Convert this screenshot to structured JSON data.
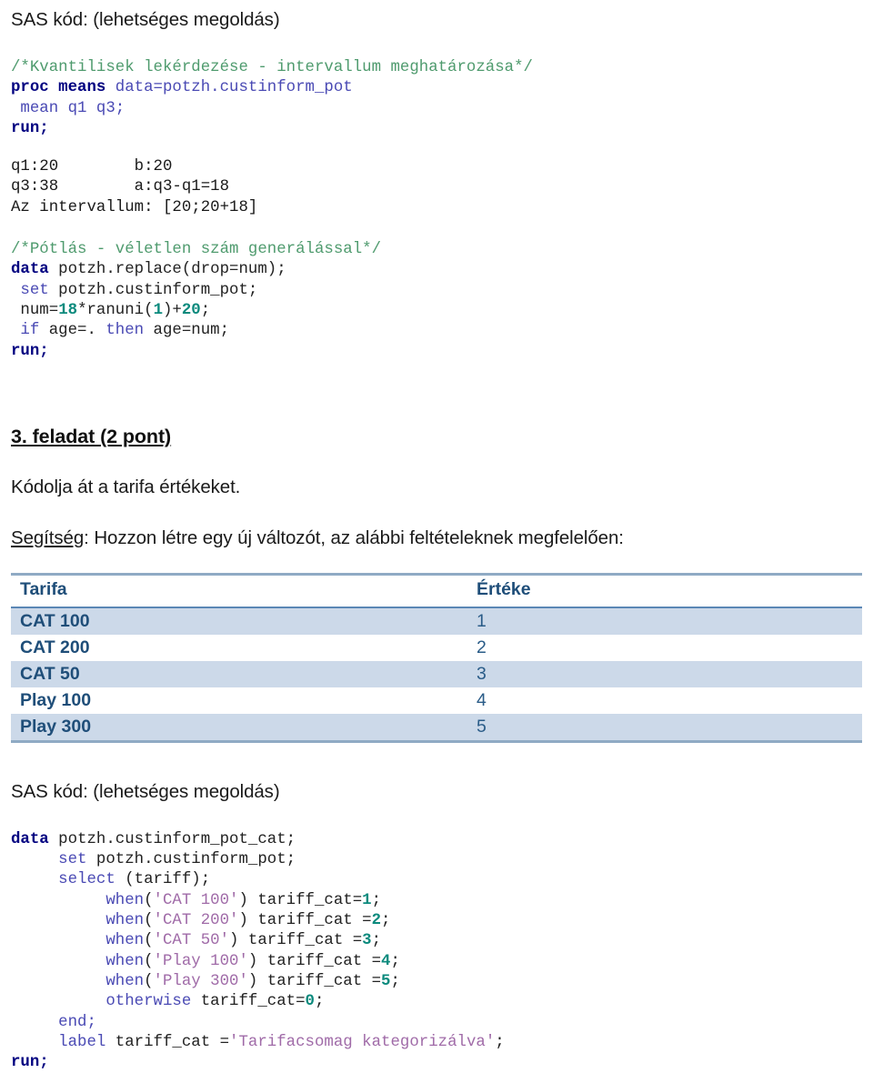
{
  "document": {
    "language": "hu",
    "colors": {
      "comment": "#4f9b6e",
      "keyword": "#000080",
      "keyword_secondary": "#4a4ab4",
      "number": "#0b8a7d",
      "string": "#a06ba8",
      "table_header_text": "#1f4e79",
      "table_row_shaded": "#ccd9e9",
      "table_border": "#8faac4"
    }
  },
  "section_one": {
    "heading": "SAS kód: (lehetséges megoldás)",
    "code_block_1": {
      "line1_comment": "/*Kvantilisek lekérdezése - intervallum meghatározása*/",
      "line2_kw": "proc means",
      "line2_rest": " data=potzh.custinform_pot",
      "line3": " mean q1 q3;",
      "line4_kw": "run;"
    },
    "output_block": {
      "line1": "q1:20        b:20",
      "line2": "q3:38        a:q3-q1=18",
      "line3": "Az intervallum: [20;20+18]"
    },
    "code_block_2": {
      "line1_comment": "/*Pótlás - véletlen szám generálással*/",
      "line2_kw": "data",
      "line2_rest": " potzh.replace(drop=num);",
      "line3_kw": " set",
      "line3_rest": " potzh.custinform_pot;",
      "line4_pre": " num=",
      "line4_num1": "18",
      "line4_mid": "*ranuni(",
      "line4_num2": "1",
      "line4_mid2": ")+",
      "line4_num3": "20",
      "line4_end": ";",
      "line5_kw1": " if",
      "line5_mid": " age=.",
      "line5_kw2": " then",
      "line5_end": " age=num;",
      "line6_kw": "run;"
    }
  },
  "section_two": {
    "heading": "3. feladat (2 pont)",
    "task_text": "Kódolja át a tarifa értékeket.",
    "hint_label": "Segítség",
    "hint_text": ": Hozzon létre egy új változót, az alábbi feltételeknek megfelelően:",
    "table": {
      "columns": [
        "Tarifa",
        "Értéke"
      ],
      "rows": [
        {
          "tarifa": "CAT 100",
          "ertek": "1"
        },
        {
          "tarifa": "CAT 200",
          "ertek": "2"
        },
        {
          "tarifa": "CAT 50",
          "ertek": "3"
        },
        {
          "tarifa": "Play 100",
          "ertek": "4"
        },
        {
          "tarifa": "Play 300",
          "ertek": "5"
        }
      ]
    }
  },
  "section_three": {
    "heading": "SAS kód: (lehetséges megoldás)",
    "code_block": {
      "l1_kw": "data",
      "l1_rest": " potzh.custinform_pot_cat;",
      "l2_kw": "     set",
      "l2_rest": " potzh.custinform_pot;",
      "l3_kw": "     select",
      "l3_rest": " (tariff);",
      "l4_kw": "          when",
      "l4_p1": "(",
      "l4_str": "'CAT 100'",
      "l4_p2": ") tariff_cat=",
      "l4_num": "1",
      "l4_end": ";",
      "l5_kw": "          when",
      "l5_p1": "(",
      "l5_str": "'CAT 200'",
      "l5_p2": ") tariff_cat =",
      "l5_num": "2",
      "l5_end": ";",
      "l6_kw": "          when",
      "l6_p1": "(",
      "l6_str": "'CAT 50'",
      "l6_p2": ") tariff_cat =",
      "l6_num": "3",
      "l6_end": ";",
      "l7_kw": "          when",
      "l7_p1": "(",
      "l7_str": "'Play 100'",
      "l7_p2": ") tariff_cat =",
      "l7_num": "4",
      "l7_end": ";",
      "l8_kw": "          when",
      "l8_p1": "(",
      "l8_str": "'Play 300'",
      "l8_p2": ") tariff_cat =",
      "l8_num": "5",
      "l8_end": ";",
      "l9_kw": "          otherwise",
      "l9_rest": " tariff_cat=",
      "l9_num": "0",
      "l9_end": ";",
      "l10_kw": "     end;",
      "l11_kw": "     label",
      "l11_mid": " tariff_cat =",
      "l11_str": "'Tarifacsomag kategorizálva'",
      "l11_end": ";",
      "l12_kw": "run;"
    }
  }
}
